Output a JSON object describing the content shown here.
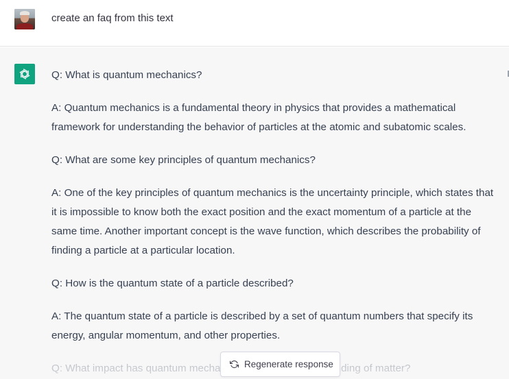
{
  "user_message": {
    "text": "create an faq from this text"
  },
  "assistant_message": {
    "paragraphs": [
      "Q: What is quantum mechanics?",
      "A: Quantum mechanics is a fundamental theory in physics that provides a mathematical framework for understanding the behavior of particles at the atomic and subatomic scales.",
      "Q: What are some key principles of quantum mechanics?",
      "A: One of the key principles of quantum mechanics is the uncertainty principle, which states that it is impossible to know both the exact position and the exact momentum of a particle at the same time. Another important concept is the wave function, which describes the probability of finding a particle at a particular location.",
      "Q: How is the quantum state of a particle described?",
      "A: The quantum state of a particle is described by a set of quantum numbers that specify its energy, angular momentum, and other properties.",
      "Q: What impact has quantum mechanics had on our understanding of matter?"
    ]
  },
  "regenerate": {
    "label": "Regenerate response",
    "icon": "refresh-icon"
  },
  "colors": {
    "brand": "#10a37f",
    "assistant_bg": "#f7f7f8",
    "text": "#374151"
  }
}
